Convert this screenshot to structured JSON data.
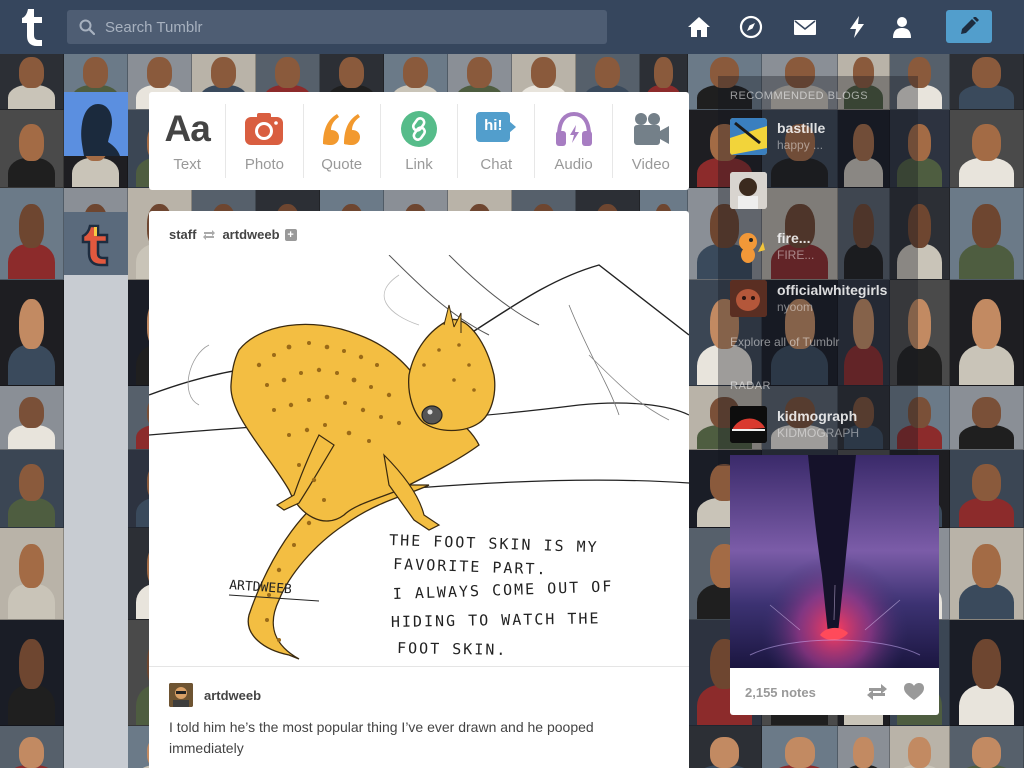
{
  "header": {
    "search_placeholder": "Search Tumblr",
    "nav_icons": [
      "home-icon",
      "explore-compass-icon",
      "inbox-mail-icon",
      "activity-lightning-icon",
      "account-person-icon"
    ],
    "compose_icon": "pencil-icon"
  },
  "post_types": [
    {
      "label": "Text",
      "icon": "Aa",
      "color": "#444444"
    },
    {
      "label": "Photo",
      "icon": "camera-icon",
      "color": "#d95e40"
    },
    {
      "label": "Quote",
      "icon": "quote-icon",
      "color": "#f2992e"
    },
    {
      "label": "Link",
      "icon": "link-icon",
      "color": "#56bc8a"
    },
    {
      "label": "Chat",
      "icon": "hi!",
      "color": "#529ecc"
    },
    {
      "label": "Audio",
      "icon": "headphones-icon",
      "color": "#a77dc2"
    },
    {
      "label": "Video",
      "icon": "video-camera-icon",
      "color": "#748089"
    }
  ],
  "post": {
    "reblogger": "staff",
    "source": "artdweeb",
    "artwork": {
      "caption_lines": [
        "THE FOOT SKIN IS MY",
        "FAVORITE PART.",
        "I ALWAYS COME OUT OF",
        "HIDING TO WATCH THE",
        "FOOT SKIN."
      ],
      "signature": "ARTDWEEB"
    },
    "author": "artdweeb",
    "body": "I told him he’s the most popular thing I’ve ever drawn and he pooped immediately"
  },
  "sidebar": {
    "recommended_heading": "Recommended Blogs",
    "recommended": [
      {
        "name": "bastille",
        "sub": "happy ..."
      },
      {
        "name": "",
        "sub": ""
      },
      {
        "name": "fire...",
        "sub": "FIRE..."
      },
      {
        "name": "officialwhitegirls",
        "sub": "nyoom"
      }
    ],
    "explore_link": "Explore all of Tumblr",
    "radar_heading": "Radar",
    "radar_blog": {
      "name": "kidmograph",
      "sub": "KIDMOGRAPH"
    },
    "radar_notes": "2,155 notes"
  },
  "colors": {
    "bar_bg": "#36465d",
    "accent": "#529ecc"
  }
}
